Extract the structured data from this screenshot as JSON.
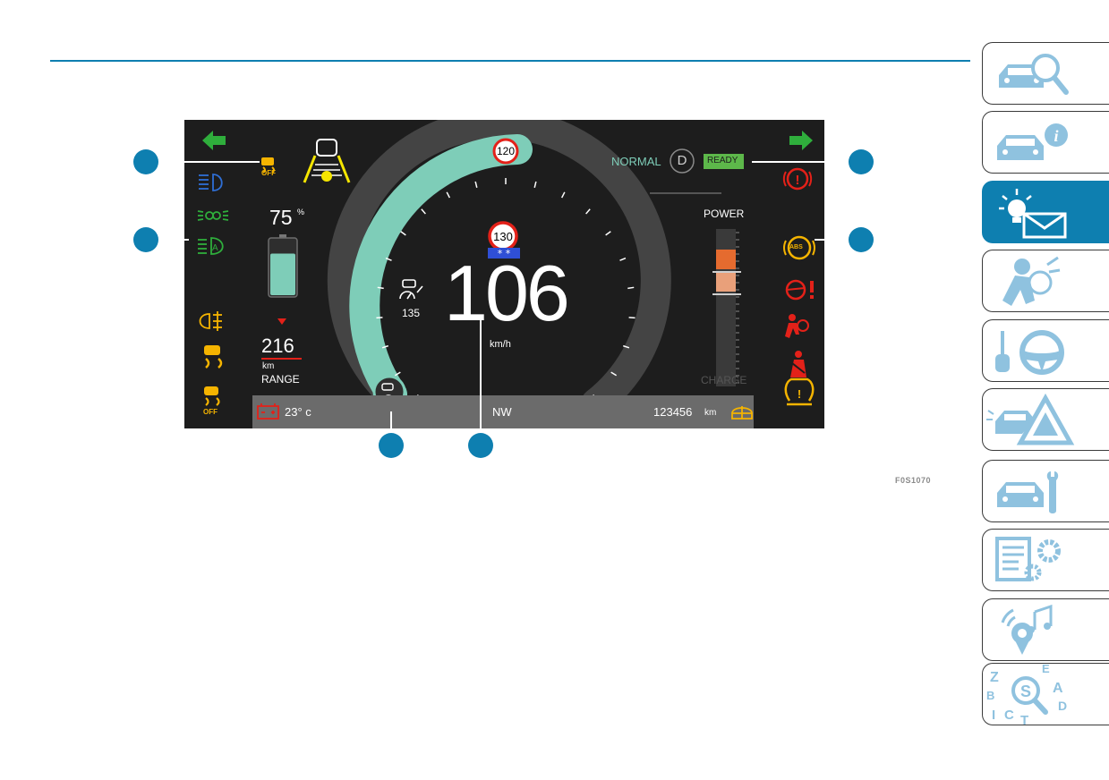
{
  "figure_code": "F0S1070",
  "cluster": {
    "speed": "106",
    "speed_unit": "km/h",
    "speed_limit_ring": "120",
    "speed_limit_sign": "130",
    "cruise_set_speed": "135",
    "battery_percent": "75",
    "battery_percent_unit": "%",
    "battery_level": 0.75,
    "range_value": "216",
    "range_unit": "km",
    "range_label": "RANGE",
    "drive_mode": "NORMAL",
    "gear": "D",
    "ready_label": "READY",
    "power_label": "POWER",
    "charge_label": "CHARGE",
    "outside_temp": "23° c",
    "compass": "NW",
    "odometer": "123456",
    "odometer_unit": "km",
    "off_label": "OFF",
    "abs_label": "ABS",
    "colors": {
      "background": "#1d1d1d",
      "arc_active": "#7ecdb8",
      "arc_inactive": "#444444",
      "warning_red": "#e32119",
      "warning_amber": "#f5b400",
      "indicator_green": "#2fae3c",
      "indicator_blue": "#2f6fd6",
      "power_orange": "#e56b2f"
    }
  },
  "tabs": [
    {
      "icon": "car-search-icon"
    },
    {
      "icon": "car-info-icon"
    },
    {
      "icon": "dashboard-lights-messages-icon",
      "active": true
    },
    {
      "icon": "airbag-seat-icon"
    },
    {
      "icon": "key-steering-wheel-icon"
    },
    {
      "icon": "car-warning-triangle-icon"
    },
    {
      "icon": "car-wrench-icon"
    },
    {
      "icon": "specifications-gear-icon"
    },
    {
      "icon": "multimedia-icon"
    },
    {
      "icon": "alphabetical-index-icon"
    }
  ]
}
